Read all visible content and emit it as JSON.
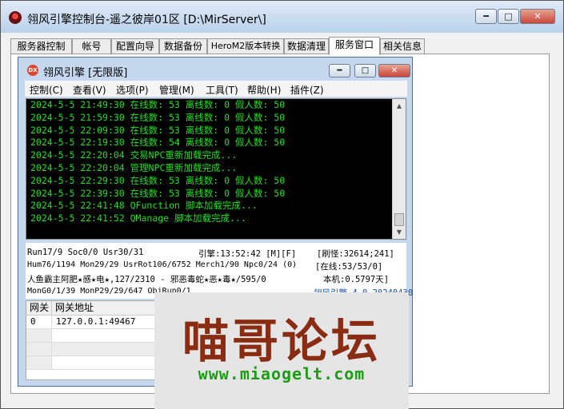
{
  "window": {
    "title": "翎风引擎控制台-遥之彼岸01区 [D:\\MirServer\\]",
    "min": "━",
    "max": "□",
    "close": "✕"
  },
  "tabs": [
    {
      "label": "服务器控制"
    },
    {
      "label": "帐号"
    },
    {
      "label": "配置向导"
    },
    {
      "label": "数据备份"
    },
    {
      "label": "HeroM2版本转换"
    },
    {
      "label": "数据清理"
    },
    {
      "label": "服务窗口",
      "active": true
    },
    {
      "label": "相关信息"
    }
  ],
  "inner": {
    "logo": "DX",
    "title": "翎风引擎 [无限版]",
    "min": "━",
    "max": "□",
    "close": "✕",
    "menu": [
      "控制(C)",
      "查看(V)",
      "选项(P)",
      "管理(M)",
      "工具(T)",
      "帮助(H)",
      "插件(Z)"
    ]
  },
  "console": {
    "lines": [
      "2024-5-5 21:49:30 在线数: 53 离线数: 0 假人数: 50",
      "2024-5-5 21:59:30 在线数: 53 离线数: 0 假人数: 50",
      "2024-5-5 22:09:30 在线数: 53 离线数: 0 假人数: 50",
      "2024-5-5 22:19:30 在线数: 54 离线数: 0 假人数: 50",
      "2024-5-5 22:20:04 交易NPC重新加载完成...",
      "2024-5-5 22:20:04 管理NPC重新加载完成...",
      "2024-5-5 22:29:30 在线数: 53 离线数: 0 假人数: 50",
      "2024-5-5 22:39:30 在线数: 53 离线数: 0 假人数: 50",
      "2024-5-5 22:41:48 QFunction 脚本加载完成...",
      "2024-5-5 22:41:52 QManage 脚本加载完成..."
    ]
  },
  "status": {
    "run": "Run17/9 Soc0/0 Usr30/31",
    "engine": "引擎:13:52:42 [M][F]",
    "refresh": "[刷怪:32614;241]",
    "hum": "Hum76/1194 Mon29/29 UsrRot106/6752 Merch1/90 Npc0/24 (0)",
    "online": "[在线:53/53/0]",
    "players": "人鱼霸主阿肥★感★电★,127/2310 - 邪恶毒蛇★恶★毒★/595/0",
    "machine": "本机:0.5797天]",
    "mongo": "MonG0/1/39 MonP29/29/647 ObjRun0/1",
    "version": "翎风引擎 4.0 20240430"
  },
  "gateway": {
    "headers": [
      "网关",
      "网关地址"
    ],
    "rows": [
      {
        "id": "0",
        "addr": "127.0.0.1:49467"
      }
    ]
  },
  "watermark": {
    "title": "喵哥论坛",
    "url": "www.miaogelt.com"
  }
}
